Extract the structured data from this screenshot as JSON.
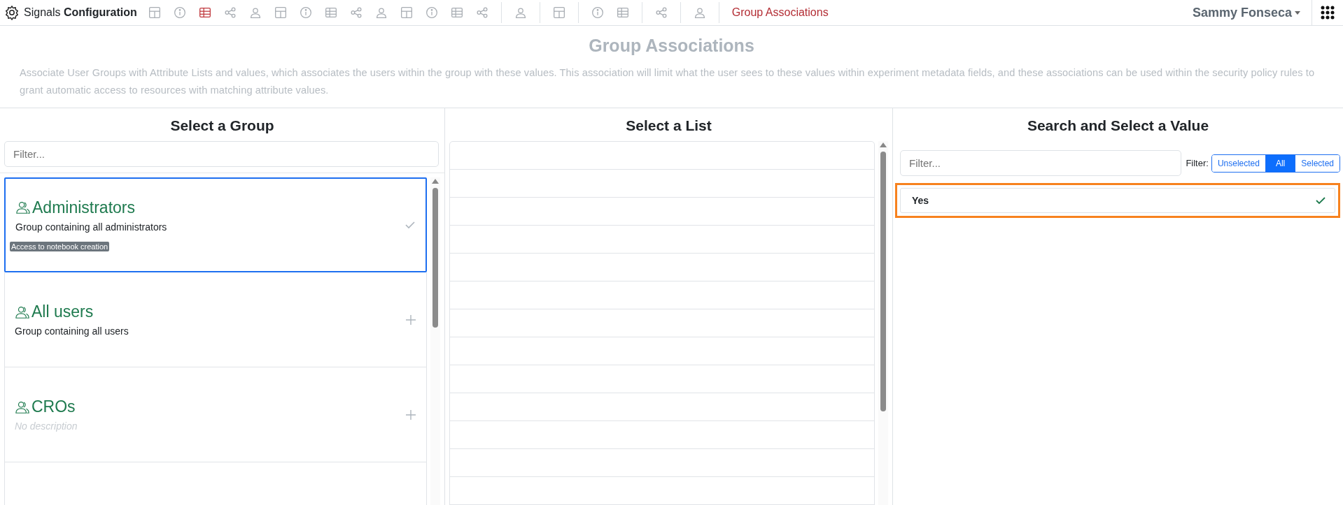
{
  "app": {
    "name_light": "Signals",
    "name_bold": "Configuration"
  },
  "toolbar": [
    {
      "selected": false
    },
    {
      "selected": false
    },
    {
      "selected": true
    },
    {
      "selected": false
    },
    {
      "selected": false
    },
    {
      "selected": false
    },
    {
      "selected": false
    },
    {
      "selected": false
    },
    {
      "selected": false
    },
    {
      "selected": false
    },
    {
      "selected": false
    },
    {
      "selected": false
    },
    {
      "selected": false
    },
    {
      "selected": false
    },
    {
      "selected": false
    },
    {
      "selected": false
    },
    {
      "selected": false
    },
    {
      "selected": false
    },
    {
      "selected": false
    },
    {
      "selected": false
    }
  ],
  "breadcrumb": "Group Associations",
  "user": {
    "name": "Sammy Fonseca"
  },
  "page": {
    "title": "Group Associations",
    "description": "Associate User Groups with Attribute Lists and values, which associates the users within the group with these values. This association will limit what the user sees to these values within experiment metadata fields, and these associations can be used within the security policy rules to grant automatic access to resources with matching attribute values."
  },
  "groups_panel": {
    "title": "Select a Group",
    "filter": {
      "placeholder": "Filter..."
    },
    "groups": [
      {
        "name": "Administrators",
        "description": "Group containing all administrators",
        "description_empty": false,
        "tags": [
          "Access to notebook creation"
        ],
        "selected": true
      },
      {
        "name": "All users",
        "description": "Group containing all users",
        "description_empty": false,
        "selected": false
      },
      {
        "name": "CROs",
        "description": "No description",
        "description_empty": true,
        "selected": false
      }
    ]
  },
  "lists_panel": {
    "title": "Select a List"
  },
  "values_panel": {
    "title": "Search and Select a Value",
    "filter": {
      "placeholder": "Filter..."
    },
    "filter_label": "Filter:",
    "filter_options": [
      {
        "label": "Unselected",
        "selected": false
      },
      {
        "label": "All",
        "selected": true
      },
      {
        "label": "Selected",
        "selected": false
      }
    ],
    "values": [
      {
        "label": "Yes",
        "selected": true,
        "highlighted": true
      }
    ]
  }
}
